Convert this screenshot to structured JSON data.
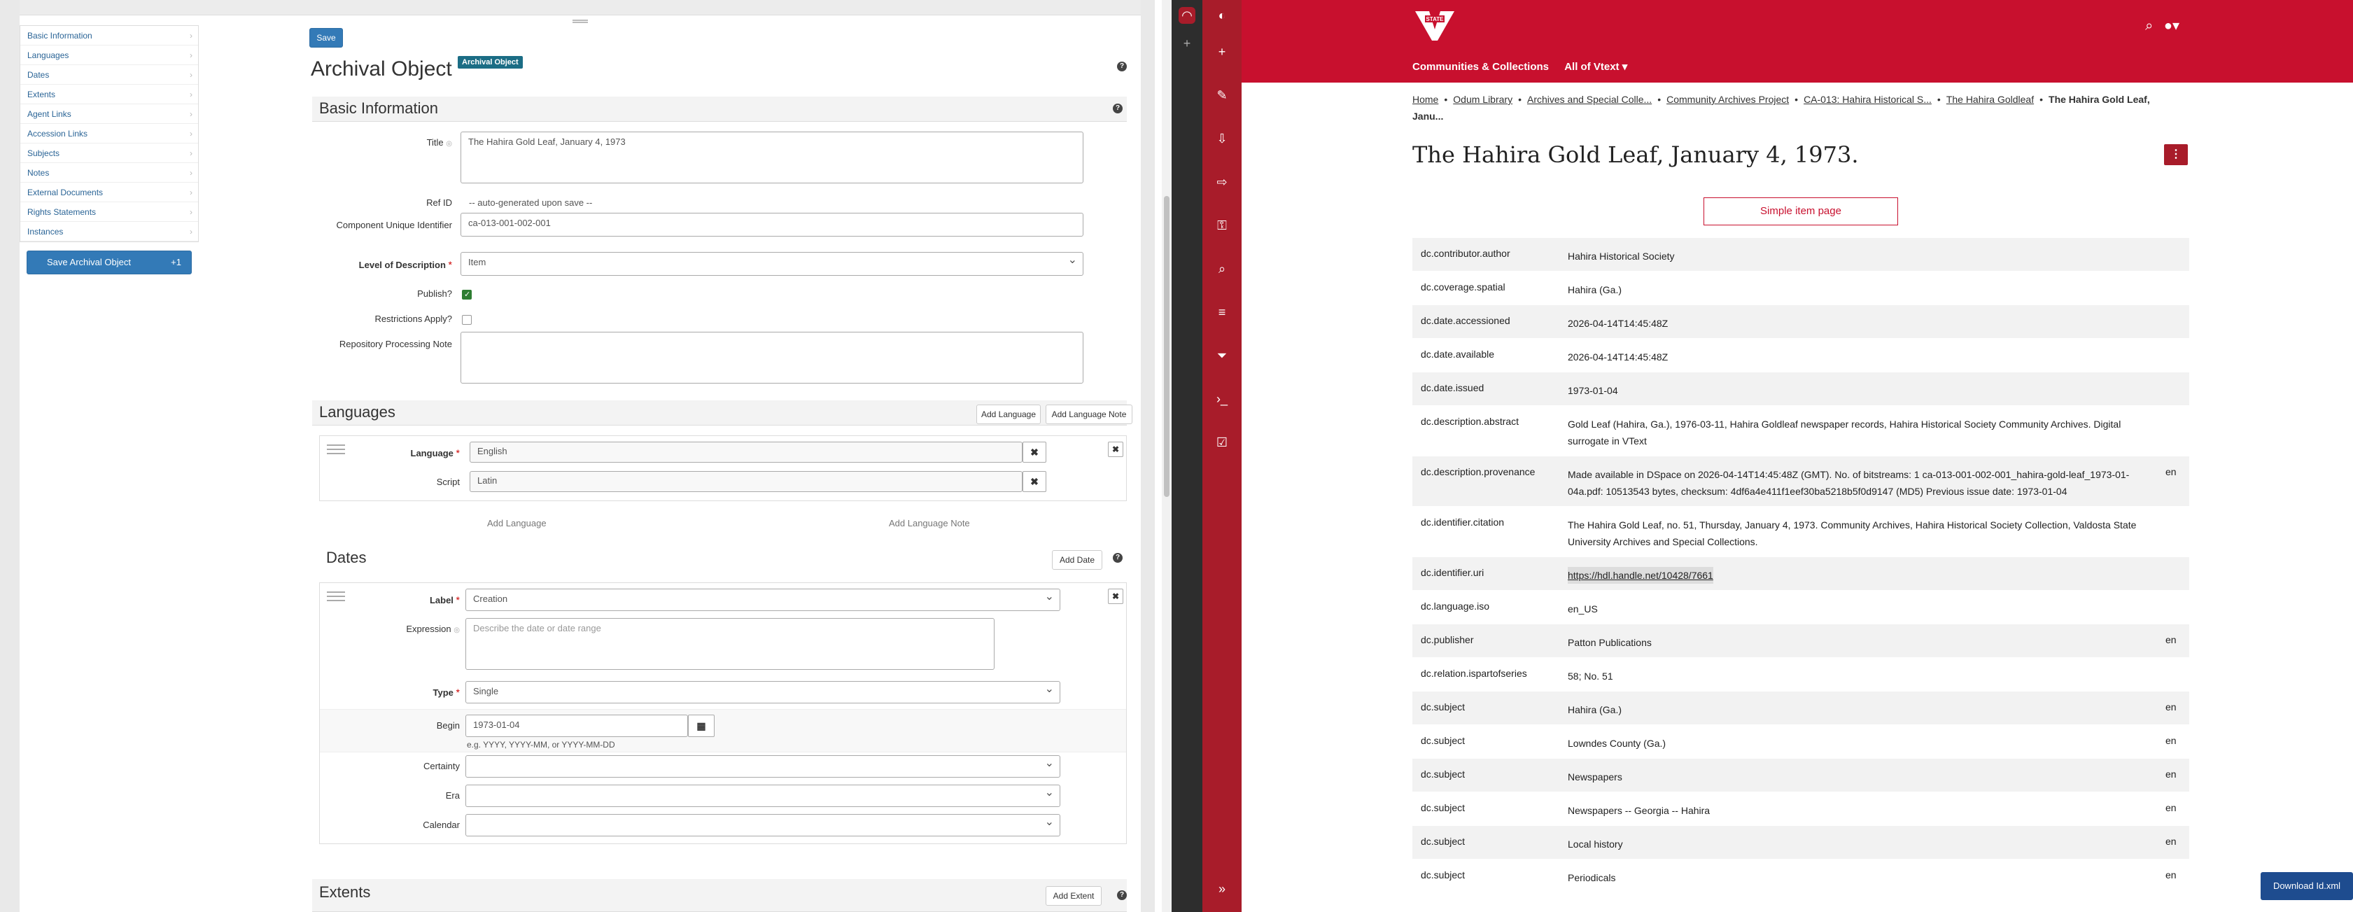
{
  "left": {
    "sidenav": [
      "Basic Information",
      "Languages",
      "Dates",
      "Extents",
      "Agent Links",
      "Accession Links",
      "Subjects",
      "Notes",
      "External Documents",
      "Rights Statements",
      "Instances"
    ],
    "save_archival": "Save Archival Object",
    "save_count": "+1",
    "save_top": "Save",
    "page_title": "Archival Object",
    "badge": "Archival Object",
    "help": "?",
    "basic": {
      "heading": "Basic Information",
      "title_label": "Title",
      "title_value": "The Hahira Gold Leaf, January 4, 1973",
      "refid_label": "Ref ID",
      "refid_value": "-- auto-generated upon save --",
      "cuid_label": "Component Unique Identifier",
      "cuid_value": "ca-013-001-002-001",
      "level_label": "Level of Description",
      "level_value": "Item",
      "publish_label": "Publish?",
      "restrict_label": "Restrictions Apply?",
      "rpn_label": "Repository Processing Note"
    },
    "languages": {
      "heading": "Languages",
      "add_lang_btn": "Add Language",
      "add_note_btn": "Add Language Note",
      "language_label": "Language",
      "language_value": "English",
      "script_label": "Script",
      "script_value": "Latin",
      "add_lang_link": "Add Language",
      "add_note_link": "Add Language Note"
    },
    "dates": {
      "heading": "Dates",
      "add_date_btn": "Add Date",
      "label_label": "Label",
      "label_value": "Creation",
      "expression_label": "Expression",
      "expression_placeholder": "Describe the date or date range",
      "type_label": "Type",
      "type_value": "Single",
      "begin_label": "Begin",
      "begin_value": "1973-01-04",
      "begin_hint": "e.g. YYYY, YYYY-MM, or YYYY-MM-DD",
      "certainty_label": "Certainty",
      "era_label": "Era",
      "calendar_label": "Calendar"
    },
    "extents": {
      "heading": "Extents",
      "add_extent_btn": "Add Extent"
    }
  },
  "right": {
    "nav": [
      "Communities & Collections",
      "All of Vtext"
    ],
    "breadcrumbs": [
      "Home",
      "Odum Library",
      "Archives and Special Colle...",
      "Community Archives Project",
      "CA-013: Hahira Historical S...",
      "The Hahira Goldleaf"
    ],
    "breadcrumb_current": "The Hahira Gold Leaf, Janu...",
    "title": "The Hahira Gold Leaf, January 4, 1973.",
    "simple_link": "Simple item page",
    "download": "Download Id.xml",
    "rows": [
      {
        "k": "dc.contributor.author",
        "v": "Hahira Historical Society",
        "l": ""
      },
      {
        "k": "dc.coverage.spatial",
        "v": "Hahira (Ga.)",
        "l": ""
      },
      {
        "k": "dc.date.accessioned",
        "v": "2026-04-14T14:45:48Z",
        "l": ""
      },
      {
        "k": "dc.date.available",
        "v": "2026-04-14T14:45:48Z",
        "l": ""
      },
      {
        "k": "dc.date.issued",
        "v": "1973-01-04",
        "l": ""
      },
      {
        "k": "dc.description.abstract",
        "v": "Gold Leaf (Hahira, Ga.), 1976-03-11, Hahira Goldleaf newspaper records, Hahira Historical Society Community Archives. Digital surrogate in VText",
        "l": ""
      },
      {
        "k": "dc.description.provenance",
        "v": "Made available in DSpace on 2026-04-14T14:45:48Z (GMT). No. of bitstreams: 1 ca-013-001-002-001_hahira-gold-leaf_1973-01-04a.pdf: 10513543 bytes, checksum: 4df6a4e411f1eef30ba5218b5f0d9147 (MD5) Previous issue date: 1973-01-04",
        "l": "en"
      },
      {
        "k": "dc.identifier.citation",
        "v": "The Hahira Gold Leaf, no. 51, Thursday, January 4, 1973. Community Archives, Hahira Historical Society Collection, Valdosta State University Archives and Special Collections.",
        "l": ""
      },
      {
        "k": "dc.identifier.uri",
        "v": "https://hdl.handle.net/10428/7661",
        "l": ""
      },
      {
        "k": "dc.language.iso",
        "v": "en_US",
        "l": ""
      },
      {
        "k": "dc.publisher",
        "v": "Patton Publications",
        "l": "en"
      },
      {
        "k": "dc.relation.ispartofseries",
        "v": "58; No. 51",
        "l": ""
      },
      {
        "k": "dc.subject",
        "v": "Hahira (Ga.)",
        "l": "en"
      },
      {
        "k": "dc.subject",
        "v": "Lowndes County (Ga.)",
        "l": "en"
      },
      {
        "k": "dc.subject",
        "v": "Newspapers",
        "l": "en"
      },
      {
        "k": "dc.subject",
        "v": "Newspapers -- Georgia -- Hahira",
        "l": "en"
      },
      {
        "k": "dc.subject",
        "v": "Local history",
        "l": "en"
      },
      {
        "k": "dc.subject",
        "v": "Periodicals",
        "l": "en"
      }
    ]
  }
}
